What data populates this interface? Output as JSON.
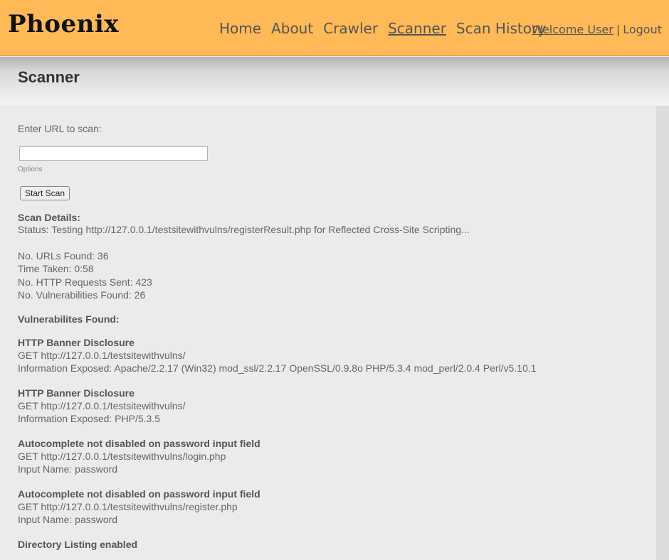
{
  "app": {
    "logo": "Phoenix"
  },
  "nav": {
    "items": [
      {
        "label": "Home"
      },
      {
        "label": "About"
      },
      {
        "label": "Crawler"
      },
      {
        "label": "Scanner"
      },
      {
        "label": "Scan History"
      }
    ],
    "active": "Scanner"
  },
  "user": {
    "welcome": "Welcome User",
    "separator": "|",
    "logout": "Logout"
  },
  "page": {
    "title": "Scanner"
  },
  "form": {
    "url_label": "Enter URL to scan:",
    "url_value": "",
    "options_label": "Options",
    "start_button": "Start Scan"
  },
  "details": {
    "heading": "Scan Details:",
    "status": "Status: Testing http://127.0.0.1/testsitewithvulns/registerResult.php for Reflected Cross-Site Scripting...",
    "urls_found": "No. URLs Found: 36",
    "time_taken": "Time Taken: 0:58",
    "requests_sent": "No. HTTP Requests Sent: 423",
    "vulns_found": "No. Vulnerabilities Found: 26"
  },
  "vulnerabilities": {
    "heading": "Vulnerabilites Found:",
    "items": [
      {
        "title": "HTTP Banner Disclosure",
        "request": "GET http://127.0.0.1/testsitewithvulns/",
        "info": "Information Exposed: Apache/2.2.17 (Win32) mod_ssl/2.2.17 OpenSSL/0.9.8o PHP/5.3.4 mod_perl/2.0.4 Perl/v5.10.1"
      },
      {
        "title": "HTTP Banner Disclosure",
        "request": "GET http://127.0.0.1/testsitewithvulns/",
        "info": "Information Exposed: PHP/5.3.5"
      },
      {
        "title": "Autocomplete not disabled on password input field",
        "request": "GET http://127.0.0.1/testsitewithvulns/login.php",
        "info": "Input Name: password"
      },
      {
        "title": "Autocomplete not disabled on password input field",
        "request": "GET http://127.0.0.1/testsitewithvulns/register.php",
        "info": "Input Name: password"
      },
      {
        "title": "Directory Listing enabled",
        "request": "",
        "info": ""
      }
    ]
  }
}
